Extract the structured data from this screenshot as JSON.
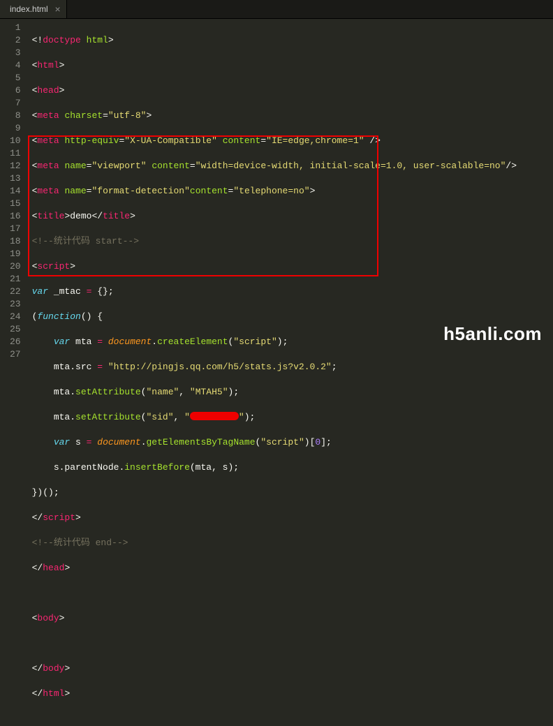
{
  "tab": {
    "title": "index.html",
    "close": "×"
  },
  "watermark": "h5anli.com",
  "gutter": [
    "1",
    "2",
    "3",
    "4",
    "5",
    "6",
    "7",
    "8",
    "9",
    "10",
    "11",
    "12",
    "13",
    "14",
    "15",
    "16",
    "17",
    "18",
    "19",
    "20",
    "21",
    "22",
    "23",
    "24",
    "25",
    "26",
    "27"
  ],
  "l1": {
    "a": "<!",
    "b": "doctype",
    "c": " ",
    "d": "html",
    "e": ">"
  },
  "l2": {
    "a": "<",
    "b": "html",
    "c": ">"
  },
  "l3": {
    "a": "<",
    "b": "head",
    "c": ">"
  },
  "l4": {
    "a": "<",
    "b": "meta",
    "c": " ",
    "d": "charset",
    "e": "=",
    "f": "\"utf-8\"",
    "g": ">"
  },
  "l5": {
    "a": "<",
    "b": "meta",
    "c": " ",
    "d": "http-equiv",
    "e": "=",
    "f": "\"X-UA-Compatible\"",
    "g": " ",
    "h": "content",
    "i": "=",
    "j": "\"IE=edge,chrome=1\"",
    "k": " />"
  },
  "l6": {
    "a": "<",
    "b": "meta",
    "c": " ",
    "d": "name",
    "e": "=",
    "f": "\"viewport\"",
    "g": " ",
    "h": "content",
    "i": "=",
    "j": "\"width=device-width, initial-scale=1.0, user-scalable=no\"",
    "k": "/>"
  },
  "l7": {
    "a": "<",
    "b": "meta",
    "c": " ",
    "d": "name",
    "e": "=",
    "f": "\"format-detection\"",
    "g": "content",
    "h": "=",
    "i": "\"telephone=no\"",
    "j": ">"
  },
  "l8": {
    "a": "<",
    "b": "title",
    "c": ">",
    "d": "demo",
    "e": "</",
    "f": "title",
    "g": ">"
  },
  "l9": {
    "a": "<!--统计代码 start-->"
  },
  "l10": {
    "a": "<",
    "b": "script",
    "c": ">"
  },
  "l11": {
    "a": "var",
    "b": " _mtac ",
    "c": "=",
    "d": " {};"
  },
  "l12": {
    "a": "(",
    "b": "function",
    "c": "() {"
  },
  "l13": {
    "a": "var",
    "b": " mta ",
    "c": "=",
    "d": " ",
    "e": "document",
    "f": ".",
    "g": "createElement",
    "h": "(",
    "i": "\"script\"",
    "j": ");"
  },
  "l14": {
    "a": "mta.src ",
    "b": "=",
    "c": " ",
    "d": "\"http://pingjs.qq.com/h5/stats.js?v2.0.2\"",
    "e": ";"
  },
  "l15": {
    "a": "mta.",
    "b": "setAttribute",
    "c": "(",
    "d": "\"name\"",
    "e": ", ",
    "f": "\"MTAH5\"",
    "g": ");"
  },
  "l16": {
    "a": "mta.",
    "b": "setAttribute",
    "c": "(",
    "d": "\"sid\"",
    "e": ", ",
    "f": "\"",
    "g": "\"",
    "h": ");"
  },
  "l17": {
    "a": "var",
    "b": " s ",
    "c": "=",
    "d": " ",
    "e": "document",
    "f": ".",
    "g": "getElementsByTagName",
    "h": "(",
    "i": "\"script\"",
    "j": ")[",
    "k": "0",
    "l": "];"
  },
  "l18": {
    "a": "s.parentNode.",
    "b": "insertBefore",
    "c": "(mta, s);"
  },
  "l19": {
    "a": "})();"
  },
  "l20": {
    "a": "</",
    "b": "script",
    "c": ">"
  },
  "l21": {
    "a": "<!--统计代码 end-->"
  },
  "l22": {
    "a": "</",
    "b": "head",
    "c": ">"
  },
  "l24": {
    "a": "<",
    "b": "body",
    "c": ">"
  },
  "l26": {
    "a": "</",
    "b": "body",
    "c": ">"
  },
  "l27": {
    "a": "</",
    "b": "html",
    "c": ">"
  }
}
